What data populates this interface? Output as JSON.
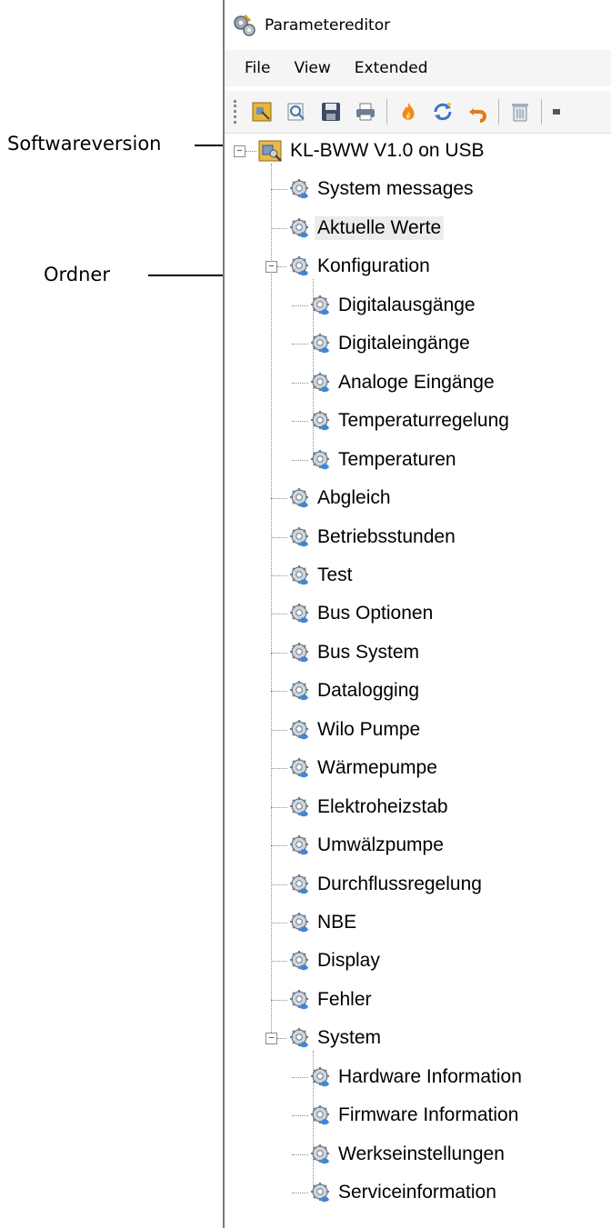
{
  "annotations": {
    "software_version_label": "Softwareversion",
    "folder_label": "Ordner"
  },
  "window": {
    "title": "Parametereditor",
    "menu": [
      "File",
      "View",
      "Extended"
    ]
  },
  "toolbar": {
    "icons": [
      "connect-icon",
      "search-icon",
      "save-icon",
      "print-icon",
      "flame-icon",
      "refresh-icon",
      "undo-icon",
      "trash-icon"
    ]
  },
  "tree": {
    "root": "KL-BWW V1.0 on USB",
    "items": [
      {
        "label": "System messages",
        "level": 1
      },
      {
        "label": "Aktuelle Werte",
        "level": 1,
        "selected": true
      },
      {
        "label": "Konfiguration",
        "level": 1,
        "expanded": true
      },
      {
        "label": "Digitalausgänge",
        "level": 2
      },
      {
        "label": "Digitaleingänge",
        "level": 2
      },
      {
        "label": "Analoge Eingänge",
        "level": 2
      },
      {
        "label": "Temperaturregelung",
        "level": 2
      },
      {
        "label": "Temperaturen",
        "level": 2
      },
      {
        "label": "Abgleich",
        "level": 1
      },
      {
        "label": "Betriebsstunden",
        "level": 1
      },
      {
        "label": "Test",
        "level": 1
      },
      {
        "label": "Bus Optionen",
        "level": 1
      },
      {
        "label": "Bus System",
        "level": 1
      },
      {
        "label": "Datalogging",
        "level": 1
      },
      {
        "label": "Wilo Pumpe",
        "level": 1
      },
      {
        "label": "Wärmepumpe",
        "level": 1
      },
      {
        "label": "Elektroheizstab",
        "level": 1
      },
      {
        "label": "Umwälzpumpe",
        "level": 1
      },
      {
        "label": "Durchflussregelung",
        "level": 1
      },
      {
        "label": "NBE",
        "level": 1
      },
      {
        "label": "Display",
        "level": 1
      },
      {
        "label": "Fehler",
        "level": 1
      },
      {
        "label": "System",
        "level": 1,
        "expanded": true
      },
      {
        "label": "Hardware Information",
        "level": 2
      },
      {
        "label": "Firmware Information",
        "level": 2
      },
      {
        "label": "Werkseinstellungen",
        "level": 2
      },
      {
        "label": "Serviceinformation",
        "level": 2
      }
    ]
  }
}
